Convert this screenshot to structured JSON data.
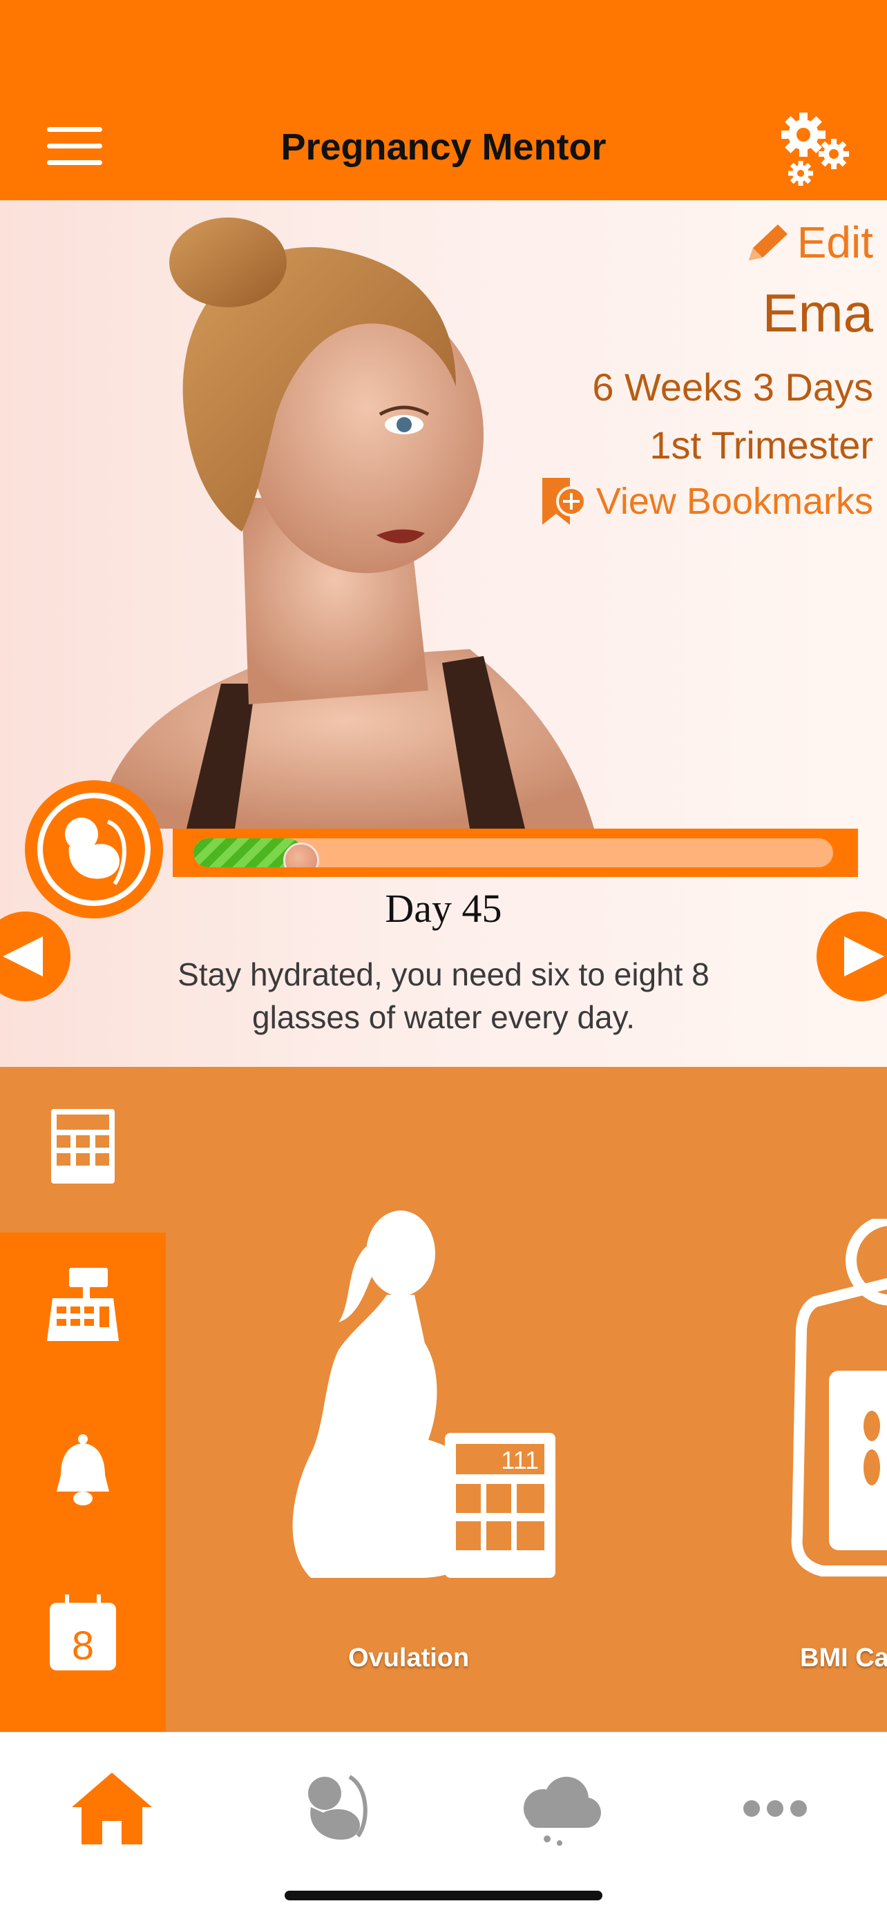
{
  "header": {
    "title": "Pregnancy Mentor",
    "menu_icon": "hamburger-menu-icon",
    "settings_icon": "gears-icon"
  },
  "profile": {
    "edit_label": "Edit",
    "name": "Ema",
    "gestation": "6 Weeks 3 Days",
    "trimester": "1st Trimester",
    "bookmarks_label": "View Bookmarks"
  },
  "progress": {
    "day_label": "Day 45",
    "fraction": 0.16
  },
  "tip": {
    "text": "Stay hydrated, you need six to eight 8 glasses of water every day."
  },
  "tools": {
    "cards": [
      {
        "label": "Ovulation"
      },
      {
        "label": "BMI Ca"
      }
    ],
    "side_icons": [
      "calculator-icon",
      "cash-register-icon",
      "bell-icon",
      "calendar-icon"
    ]
  },
  "tabbar": {
    "tabs": [
      {
        "icon": "home-icon",
        "active": true
      },
      {
        "icon": "fetus-icon",
        "active": false
      },
      {
        "icon": "cloud-icon",
        "active": false
      },
      {
        "icon": "more-icon",
        "active": false
      }
    ]
  },
  "colors": {
    "brand_orange": "#ff7700",
    "panel_orange": "#e88b3a",
    "text_brown": "#b85c12"
  }
}
